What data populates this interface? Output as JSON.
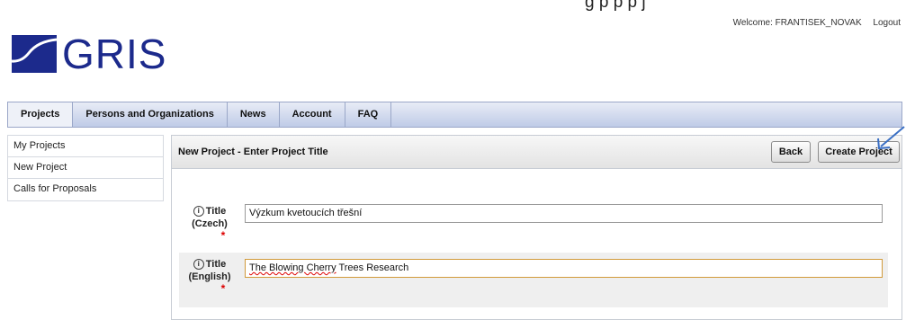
{
  "top_note": "g          p  p  p  j",
  "header": {
    "welcome_text": "Welcome: FRANTISEK_NOVAK",
    "logout_label": "Logout"
  },
  "logo": {
    "text": "GRIS"
  },
  "nav": {
    "items": [
      {
        "label": "Projects"
      },
      {
        "label": "Persons and Organizations"
      },
      {
        "label": "News"
      },
      {
        "label": "Account"
      },
      {
        "label": "FAQ"
      }
    ]
  },
  "sidebar": {
    "items": [
      {
        "label": "My Projects"
      },
      {
        "label": "New Project"
      },
      {
        "label": "Calls for Proposals"
      }
    ]
  },
  "panel": {
    "title": "New Project - Enter Project Title",
    "back_label": "Back",
    "create_label": "Create Project"
  },
  "form": {
    "title_czech": {
      "label_line1": "Title",
      "label_line2": "(Czech)",
      "value": "Výzkum kvetoucích třešní"
    },
    "title_english": {
      "label_line1": "Title",
      "label_line2": "(English)",
      "value_part1": "The Blowing Cherry",
      "value_part2": " Trees Research"
    },
    "required_mark": "*",
    "info_glyph": "i"
  },
  "colors": {
    "brand": "#1c2a8c",
    "annotation_arrow": "#3a6fc4"
  }
}
